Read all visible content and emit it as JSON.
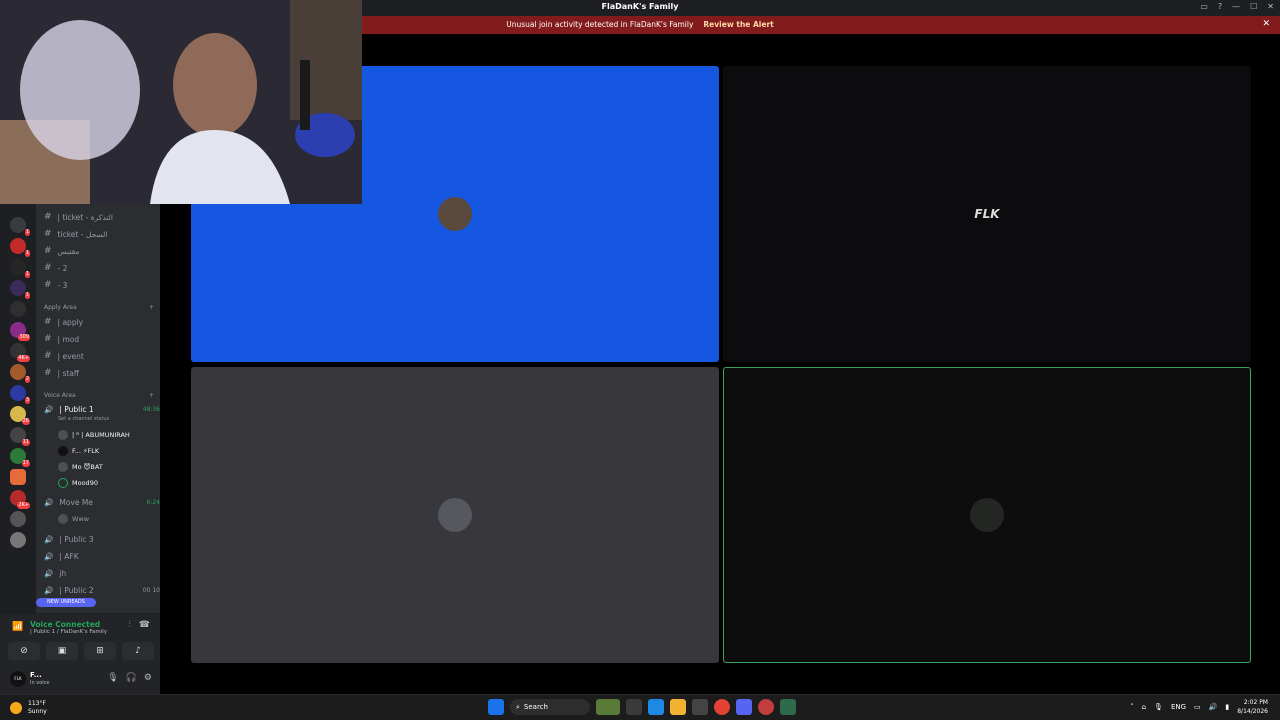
{
  "window": {
    "title": "FlaDanK's Family"
  },
  "alert": {
    "text": "Unusual join activity detected in FlaDanK's Family",
    "action": "Review the Alert"
  },
  "channels": {
    "top_label": "Apply Area",
    "text1": [
      {
        "name": "| ticket - التذكرة"
      },
      {
        "name": "ticket - السجل"
      },
      {
        "name": "مقتبس"
      },
      {
        "name": "- 2"
      },
      {
        "name": "- 3"
      }
    ],
    "cat_apply": "Apply Area",
    "apply": [
      {
        "name": "| apply"
      },
      {
        "name": "| mod"
      },
      {
        "name": "| event"
      },
      {
        "name": "| staff"
      }
    ],
    "cat_voice": "Voice Area",
    "public1": {
      "name": "| Public 1",
      "time": "48:36",
      "status": "Set a channel status"
    },
    "members": [
      {
        "name": "| ᴿ | ABUMUNIRAH"
      },
      {
        "name": "F... ⚡FLK"
      },
      {
        "name": "Mo 😈BAT"
      },
      {
        "name": "Mood90"
      }
    ],
    "moveme": {
      "name": "Move Me",
      "time": "6:24"
    },
    "moveme_member": "Www",
    "public3": "| Public 3",
    "afk": "| AFK",
    "jh": "jh",
    "public2": {
      "name": "| Public 2",
      "c1": "00",
      "c2": "10"
    },
    "new_unreads": "NEW UNREADS"
  },
  "voice": {
    "title": "Voice Connected",
    "sub": "| Public 1 / FlaDanK's Family"
  },
  "user": {
    "name": "F...",
    "status": "In voice",
    "avatar_text": "FLK"
  },
  "stage": {
    "tile2_label": "FLK"
  },
  "taskbar": {
    "weather_temp": "113°F",
    "weather_text": "Sunny",
    "search": "Search",
    "lang": "ENG",
    "time": "2:02 PM",
    "date": "8/14/2026"
  },
  "guild_badges": [
    "1",
    "1",
    "1",
    "",
    "309",
    "4K+",
    "2",
    "3",
    "26",
    "11",
    "17",
    "",
    "2K+",
    "",
    ""
  ],
  "colors": {
    "blurple": "#1557e0",
    "voice_green": "#23a55a",
    "alert_red": "#821b1b"
  }
}
